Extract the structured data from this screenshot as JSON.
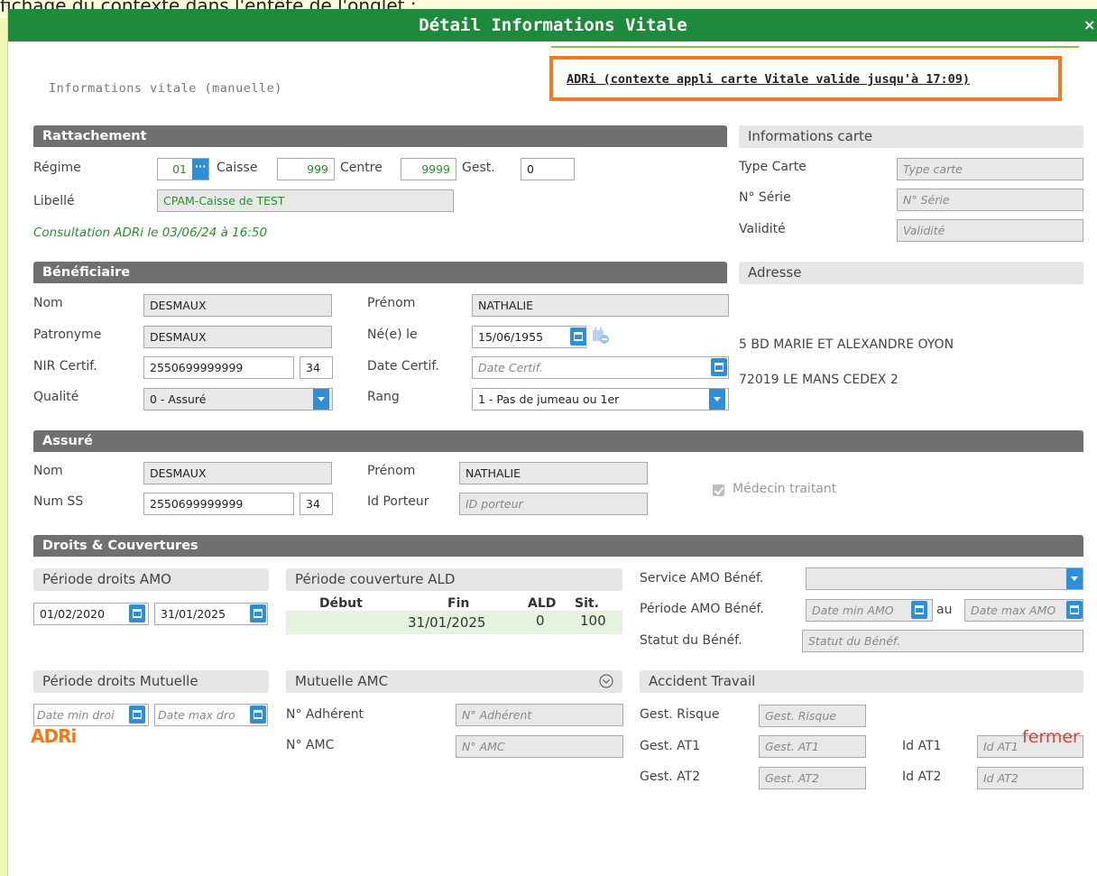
{
  "background_text": "fichage du contexte dans l'entête de l'onglet :",
  "dialog": {
    "title": "Détail Informations Vitale",
    "close_label": "×"
  },
  "header": {
    "mode_label": "Informations vitale (manuelle)",
    "context_link": "ADRi (contexte appli carte Vitale valide jusqu'à 17:09)"
  },
  "rattachement": {
    "section": "Rattachement",
    "regime_label": "Régime",
    "regime_value": "01",
    "caisse_label": "Caisse",
    "caisse_value": "999",
    "centre_label": "Centre",
    "centre_value": "9999",
    "gest_label": "Gest.",
    "gest_value": "0",
    "libelle_label": "Libellé",
    "libelle_value": "CPAM-Caisse de TEST",
    "consultation": "Consultation ADRi le 03/06/24 à 16:50"
  },
  "carte": {
    "section": "Informations carte",
    "type_label": "Type Carte",
    "type_placeholder": "Type carte",
    "serie_label": "N° Série",
    "serie_placeholder": "N° Série",
    "validite_label": "Validité",
    "validite_placeholder": "Validité"
  },
  "beneficiaire": {
    "section": "Bénéficiaire",
    "nom_label": "Nom",
    "nom_value": "DESMAUX",
    "prenom_label": "Prénom",
    "prenom_value": "NATHALIE",
    "patronyme_label": "Patronyme",
    "patronyme_value": "DESMAUX",
    "naissance_label": "Né(e) le",
    "naissance_value": "15/06/1955",
    "nir_label": "NIR Certif.",
    "nir_value": "2550699999999",
    "nir_key": "34",
    "datecertif_label": "Date Certif.",
    "datecertif_placeholder": "Date Certif.",
    "qualite_label": "Qualité",
    "qualite_value": "0 - Assuré",
    "rang_label": "Rang",
    "rang_value": "1 - Pas de jumeau ou 1er"
  },
  "adresse": {
    "section": "Adresse",
    "line1": "5 BD MARIE ET ALEXANDRE OYON",
    "line2": "72019 LE MANS CEDEX 2"
  },
  "assure": {
    "section": "Assuré",
    "nom_label": "Nom",
    "nom_value": "DESMAUX",
    "prenom_label": "Prénom",
    "prenom_value": "NATHALIE",
    "numss_label": "Num SS",
    "numss_value": "2550699999999",
    "numss_key": "34",
    "porteur_label": "Id Porteur",
    "porteur_placeholder": "ID porteur",
    "medecin_label": "Médecin traitant"
  },
  "droits": {
    "section": "Droits & Couvertures",
    "amo_section": "Période droits AMO",
    "amo_start": "01/02/2020",
    "amo_end": "31/01/2025",
    "ald_section": "Période couverture ALD",
    "ald_headers": [
      "Début",
      "Fin",
      "ALD",
      "Sit."
    ],
    "ald_row": {
      "debut": "",
      "fin": "31/01/2025",
      "ald": "0",
      "sit": "100"
    },
    "service_label": "Service AMO Bénéf.",
    "periode_label": "Période AMO Bénéf.",
    "periode_min_placeholder": "Date min AMO",
    "periode_au": "au",
    "periode_max_placeholder": "Date max AMO",
    "statut_label": "Statut du Bénéf.",
    "statut_placeholder": "Statut du Bénéf.",
    "mutuelle_section": "Période droits Mutuelle",
    "mut_min_placeholder": "Date min droi",
    "mut_max_placeholder": "Date max dro",
    "amc_section": "Mutuelle AMC",
    "adherent_label": "N° Adhérent",
    "adherent_placeholder": "N° Adhérent",
    "amc_label": "N° AMC",
    "amc_placeholder": "N° AMC",
    "at_section": "Accident Travail",
    "risque_label": "Gest. Risque",
    "risque_placeholder": "Gest. Risque",
    "at1_label": "Gest. AT1",
    "at1_placeholder": "Gest. AT1",
    "idat1_label": "Id AT1",
    "idat1_placeholder": "Id AT1",
    "at2_label": "Gest. AT2",
    "at2_placeholder": "Gest. AT2",
    "idat2_label": "Id AT2",
    "idat2_placeholder": "Id AT2"
  },
  "footer": {
    "logo_text": "ADRi",
    "close_label": "fermer"
  },
  "colors": {
    "titlebar": "#1e8a3c",
    "accent_blue": "#2d8fd8",
    "highlight_orange": "#f57920",
    "green_text": "#2a8f2a",
    "section_gray": "#707070"
  }
}
